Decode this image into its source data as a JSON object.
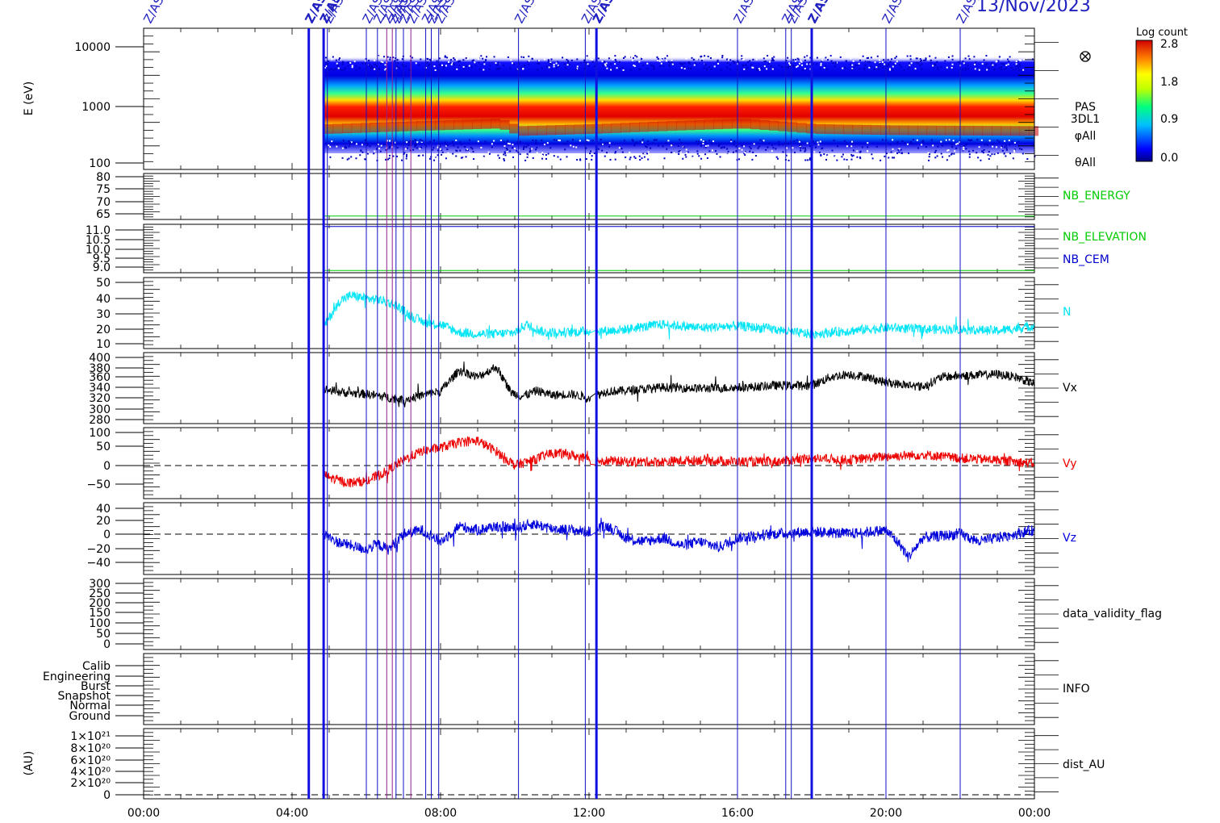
{
  "header": {
    "date": "13/Nov/2023",
    "event_label_visible": "Z/AS",
    "event_label_bold": "Z/AS"
  },
  "colorbar": {
    "title": "Log count",
    "ticks": [
      "2.8",
      "1.8",
      "0.9",
      "0.0"
    ]
  },
  "x_axis": {
    "ticks": [
      "00:00",
      "04:00",
      "08:00",
      "12:00",
      "16:00",
      "20:00",
      "00:00"
    ]
  },
  "events": {
    "thin": [
      4.95,
      6.0,
      6.3,
      6.8,
      7.0,
      7.6,
      7.75,
      7.95,
      10.1,
      11.9,
      16.0,
      17.3,
      17.45,
      20.0,
      22.0
    ],
    "bold": [
      4.45,
      4.85,
      12.2,
      18.0
    ],
    "purple": [
      6.55,
      6.7,
      7.2
    ]
  },
  "panels": [
    {
      "id": "energy",
      "ylabel": "E (eV)",
      "right_labels": [
        "PAS",
        "3DL1",
        "φAll",
        "θAll"
      ],
      "yticks": [
        "10000",
        "1000",
        "100"
      ]
    },
    {
      "id": "nb_energy",
      "right_labels": [
        "NB_ENERGY"
      ],
      "yticks": [
        "80",
        "75",
        "70",
        "65"
      ]
    },
    {
      "id": "nb_elev",
      "right_labels": [
        "NB_ELEVATION",
        "NB_CEM"
      ],
      "yticks": [
        "11.0",
        "10.5",
        "10.0",
        "9.5",
        "9.0"
      ]
    },
    {
      "id": "n",
      "right_labels": [
        "N"
      ],
      "yticks": [
        "50",
        "40",
        "30",
        "20",
        "10"
      ]
    },
    {
      "id": "vx",
      "right_labels": [
        "Vx"
      ],
      "yticks": [
        "400",
        "380",
        "360",
        "340",
        "320",
        "300",
        "280"
      ]
    },
    {
      "id": "vy",
      "right_labels": [
        "Vy"
      ],
      "yticks": [
        "100",
        "50",
        "0",
        "−50"
      ]
    },
    {
      "id": "vz",
      "right_labels": [
        "Vz"
      ],
      "yticks": [
        "40",
        "20",
        "0",
        "−20",
        "−40"
      ]
    },
    {
      "id": "dvf",
      "right_labels": [
        "data_validity_flag"
      ],
      "yticks": [
        "300",
        "250",
        "200",
        "150",
        "100",
        "50",
        "0"
      ]
    },
    {
      "id": "info",
      "right_labels": [
        "INFO"
      ],
      "yticks": [
        "Calib",
        "Engineering",
        "Burst",
        "Snapshot",
        "Normal",
        "Ground"
      ]
    },
    {
      "id": "dist",
      "ylabel": "(AU)",
      "right_labels": [
        "dist_AU"
      ],
      "yticks": [
        "1×10²¹",
        "8×10²⁰",
        "6×10²⁰",
        "4×10²⁰",
        "2×10²⁰",
        "0"
      ]
    }
  ],
  "chart_data": [
    {
      "type": "heatmap",
      "title": "PAS 3DL1",
      "ylabel": "E (eV)",
      "yscale": "log",
      "ylim": [
        100,
        20000
      ],
      "xlim_hours": [
        0,
        24
      ],
      "data_start_hour": 4.85,
      "color_scale": {
        "label": "Log count",
        "min": 0.0,
        "max": 2.8
      },
      "peak_energy_eV": [
        [
          4.9,
          650
        ],
        [
          8.0,
          750
        ],
        [
          9.5,
          800
        ],
        [
          10.0,
          600
        ],
        [
          12.0,
          650
        ],
        [
          16.0,
          800
        ],
        [
          18.0,
          650
        ],
        [
          20.0,
          620
        ],
        [
          24.0,
          600
        ]
      ]
    },
    {
      "type": "line",
      "series": [
        {
          "name": "NB_ENERGY",
          "color": "#00cc00",
          "x": [
            4.85,
            24.0
          ],
          "y": [
            63.5,
            63.5
          ]
        }
      ],
      "ylim": [
        62,
        82
      ]
    },
    {
      "type": "line",
      "series": [
        {
          "name": "NB_ELEVATION",
          "color": "#00cc00",
          "x": [
            4.85,
            24.0
          ],
          "y": [
            9.0,
            9.0
          ]
        },
        {
          "name": "NB_CEM",
          "color": "#0000cc",
          "x": [
            4.85,
            24.0
          ],
          "y": [
            11.0,
            11.0
          ]
        }
      ],
      "ylim": [
        8.9,
        11.1
      ]
    },
    {
      "type": "line",
      "series": [
        {
          "name": "N",
          "color": "#00e5f5",
          "x": [
            4.85,
            5.0,
            5.3,
            5.6,
            6.0,
            6.4,
            6.8,
            7.2,
            7.6,
            8.0,
            8.5,
            9.0,
            9.5,
            10.0,
            10.3,
            10.8,
            11.5,
            12.0,
            12.5,
            13.0,
            14.0,
            15.0,
            16.0,
            17.0,
            17.5,
            18.0,
            19.0,
            20.0,
            21.0,
            22.0,
            23.0,
            24.0
          ],
          "y": [
            20,
            26,
            37,
            40,
            38,
            37,
            34,
            27,
            23,
            22,
            17,
            16,
            16,
            17,
            22,
            17,
            17,
            18,
            18,
            19,
            22,
            20,
            21,
            19,
            17,
            16,
            18,
            20,
            19,
            19,
            18,
            21
          ]
        }
      ],
      "ylim": [
        7,
        51
      ]
    },
    {
      "type": "line",
      "series": [
        {
          "name": "Vx",
          "color": "#000000",
          "x": [
            4.85,
            5.5,
            6.0,
            6.5,
            7.0,
            7.5,
            8.0,
            8.5,
            9.0,
            9.5,
            9.9,
            10.2,
            10.6,
            11.0,
            11.5,
            12.0,
            12.5,
            13.0,
            14.0,
            15.0,
            16.0,
            17.0,
            18.0,
            18.5,
            19.0,
            19.5,
            20.0,
            21.0,
            21.5,
            22.0,
            23.0,
            23.5,
            24.0
          ],
          "y": [
            338,
            332,
            330,
            325,
            320,
            328,
            335,
            372,
            360,
            378,
            333,
            326,
            336,
            328,
            330,
            324,
            335,
            336,
            342,
            340,
            341,
            345,
            345,
            360,
            365,
            360,
            350,
            343,
            360,
            362,
            365,
            360,
            348
          ]
        }
      ],
      "ylim": [
        278,
        403
      ]
    },
    {
      "type": "line",
      "series": [
        {
          "name": "Vy",
          "color": "#ee0000",
          "x": [
            4.85,
            5.0,
            5.5,
            6.0,
            6.5,
            7.0,
            7.5,
            8.0,
            8.5,
            9.0,
            9.5,
            10.0,
            10.5,
            11.0,
            11.5,
            12.0,
            13.0,
            14.0,
            15.0,
            16.0,
            17.0,
            18.0,
            19.0,
            20.0,
            21.0,
            22.0,
            23.0,
            24.0
          ],
          "y": [
            -20,
            -30,
            -45,
            -40,
            -15,
            20,
            45,
            55,
            70,
            75,
            45,
            5,
            20,
            40,
            35,
            20,
            15,
            15,
            20,
            15,
            15,
            25,
            20,
            30,
            35,
            25,
            20,
            10
          ]
        }
      ],
      "ylim": [
        -90,
        112
      ],
      "reference_line": 0
    },
    {
      "type": "line",
      "series": [
        {
          "name": "Vz",
          "color": "#0000dd",
          "x": [
            4.85,
            5.2,
            5.6,
            6.0,
            6.3,
            6.6,
            7.0,
            7.5,
            8.0,
            8.5,
            9.0,
            9.5,
            10.0,
            10.5,
            11.0,
            11.5,
            12.0,
            12.5,
            13.0,
            13.5,
            14.0,
            14.5,
            15.0,
            15.5,
            16.0,
            17.0,
            18.0,
            19.0,
            20.0,
            20.4,
            20.6,
            21.0,
            22.0,
            22.5,
            23.0,
            24.0
          ],
          "y": [
            5,
            -5,
            -10,
            -15,
            -8,
            -15,
            5,
            10,
            -5,
            15,
            10,
            15,
            12,
            18,
            12,
            10,
            8,
            15,
            0,
            -5,
            0,
            -10,
            -5,
            -12,
            0,
            5,
            8,
            5,
            10,
            -10,
            -25,
            0,
            5,
            -5,
            0,
            10
          ]
        }
      ],
      "ylim": [
        -47,
        45
      ],
      "reference_line": 0
    },
    {
      "type": "line",
      "series": [
        {
          "name": "data_validity_flag",
          "x": [],
          "y": []
        }
      ],
      "ylim": [
        0,
        300
      ]
    },
    {
      "type": "line",
      "series": [
        {
          "name": "INFO",
          "x": [],
          "y": []
        }
      ],
      "categories": [
        "Calib",
        "Engineering",
        "Burst",
        "Snapshot",
        "Normal",
        "Ground"
      ]
    },
    {
      "type": "line",
      "series": [
        {
          "name": "dist_AU",
          "x": [],
          "y": []
        }
      ],
      "ylim": [
        0,
        1e+21
      ],
      "reference_line": 0
    }
  ]
}
